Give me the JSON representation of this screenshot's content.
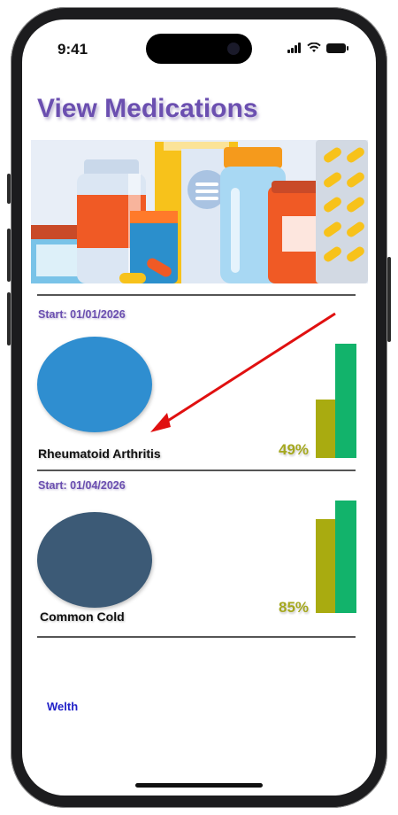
{
  "status_bar": {
    "time": "9:41"
  },
  "page": {
    "title": "View Medications"
  },
  "medications": [
    {
      "start_label": "Start: 01/01/2026",
      "name": "Rheumatoid Arthritis",
      "percent_label": "49%",
      "circle_color": "#2f8ed0"
    },
    {
      "start_label": "Start: 01/04/2026",
      "name": "Common Cold",
      "percent_label": "85%",
      "circle_color": "#3c5a76"
    }
  ],
  "footer": {
    "link_label": "Welth"
  },
  "colors": {
    "accent": "#6b4fb0",
    "bar_olive": "#a9ab10",
    "bar_green": "#12b36b",
    "annotation_arrow": "#e01010"
  }
}
